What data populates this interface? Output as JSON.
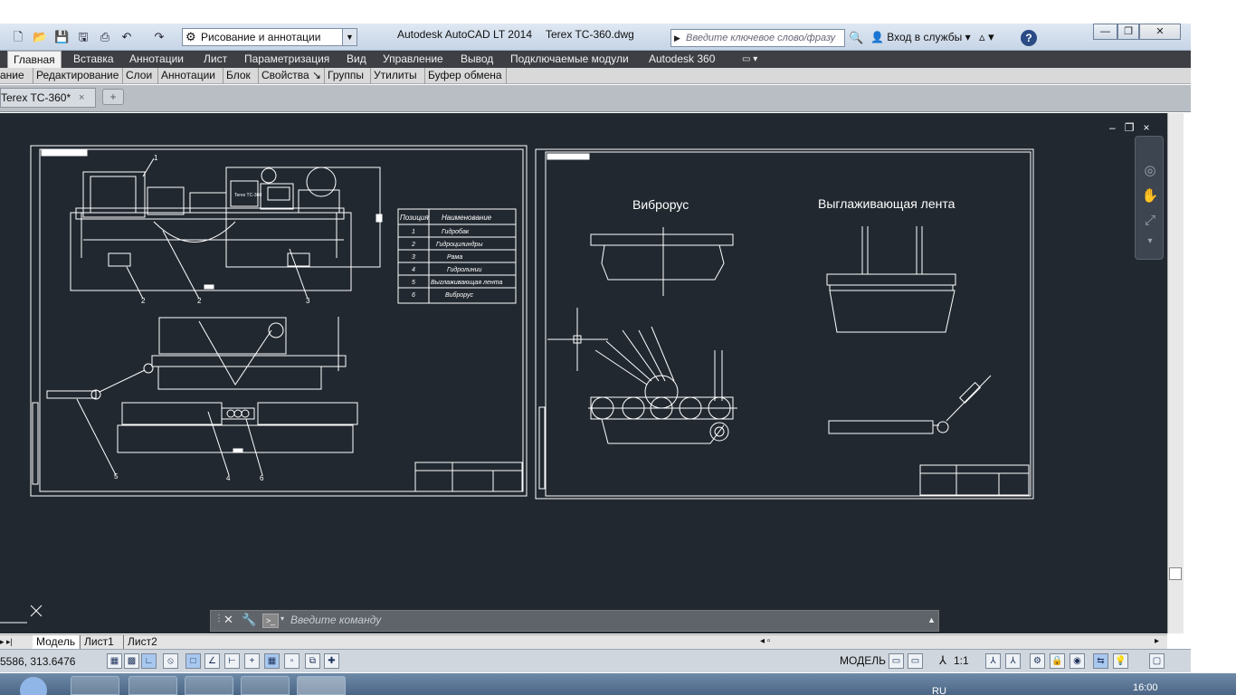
{
  "titlebar": {
    "workspace": "Рисование и аннотации",
    "app_name": "Autodesk AutoCAD LT 2014",
    "document": "Terex TC-360.dwg",
    "search_placeholder": "Введите ключевое слово/фразу",
    "signin": "Вход в службы",
    "help": "?"
  },
  "ribbon_tabs": [
    "Главная",
    "Вставка",
    "Аннотации",
    "Лист",
    "Параметризация",
    "Вид",
    "Управление",
    "Вывод",
    "Подключаемые модули",
    "Autodesk 360"
  ],
  "ribbon_panels": [
    "ание",
    "Редактирование",
    "Слои",
    "Аннотации",
    "Блок",
    "Свойства",
    "Группы",
    "Утилиты",
    "Буфер обмена"
  ],
  "file_tab": {
    "label": "Terex TC-360*",
    "close": "×"
  },
  "viewport_controls": [
    "–",
    "❐",
    "×"
  ],
  "sheet_left": {
    "table_header": [
      "Позиция",
      "Наименование"
    ],
    "table_rows": [
      [
        "1",
        "Гидробак"
      ],
      [
        "2",
        "Гидроцилиндры"
      ],
      [
        "3",
        "Рама"
      ],
      [
        "4",
        "Гидролинии"
      ],
      [
        "5",
        "Выглаживающая лента"
      ],
      [
        "6",
        "Виброрус"
      ]
    ],
    "callouts": [
      "1",
      "2",
      "2",
      "3",
      "5",
      "4",
      "6"
    ],
    "machine_label": "Terex TC-360"
  },
  "sheet_right": {
    "title_vibrobrus": "Виброрус",
    "title_lenta": "Выглаживающая лента"
  },
  "layout_tabs": [
    "Модель",
    "Лист1",
    "Лист2"
  ],
  "command_line": {
    "placeholder": "Введите команду"
  },
  "status": {
    "coords": "5586, 313.6476",
    "model": "МОДЕЛЬ",
    "scale": "1:1"
  },
  "tray": {
    "lang": "RU",
    "time": "16:00"
  },
  "colors": {
    "canvas": "#212830",
    "ribbon_dark": "#3d3f44",
    "lines": "#ffffff"
  }
}
